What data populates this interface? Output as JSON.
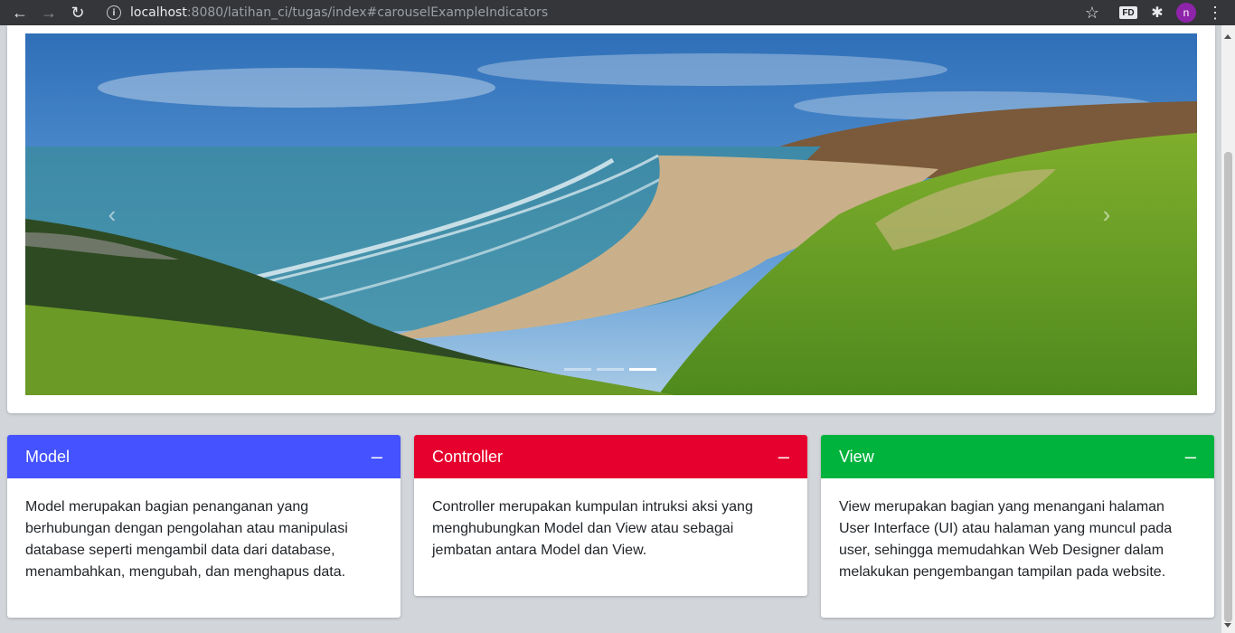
{
  "browser": {
    "url_host": "localhost",
    "url_path": ":8080/latihan_ci/tugas/index#carouselExampleIndicators",
    "back_icon": "←",
    "forward_icon": "→",
    "reload_icon": "↻",
    "info_icon": "i",
    "star_icon": "☆",
    "extension_fd": "FD",
    "extensions_icon": "✱",
    "avatar_letter": "n",
    "menu_icon": "⋮"
  },
  "carousel": {
    "prev_icon": "‹",
    "next_icon": "›",
    "slide_count": 3,
    "active_slide": 3
  },
  "cards": [
    {
      "title": "Model",
      "minimize": "–",
      "color": "#4452ff",
      "text": "Model merupakan bagian penanganan yang berhubungan dengan pengolahan atau manipulasi database seperti mengambil data dari database, menambahkan, mengubah, dan menghapus data."
    },
    {
      "title": "Controller",
      "minimize": "–",
      "color": "#e6002d",
      "text": "Controller merupakan kumpulan intruksi aksi yang menghubungkan Model dan View atau sebagai jembatan antara Model dan View."
    },
    {
      "title": "View",
      "minimize": "–",
      "color": "#00b33c",
      "text": "View merupakan bagian yang menangani halaman User Interface (UI) atau halaman yang muncul pada user, sehingga memudahkan Web Designer dalam melakukan pengembangan tampilan pada website."
    }
  ]
}
